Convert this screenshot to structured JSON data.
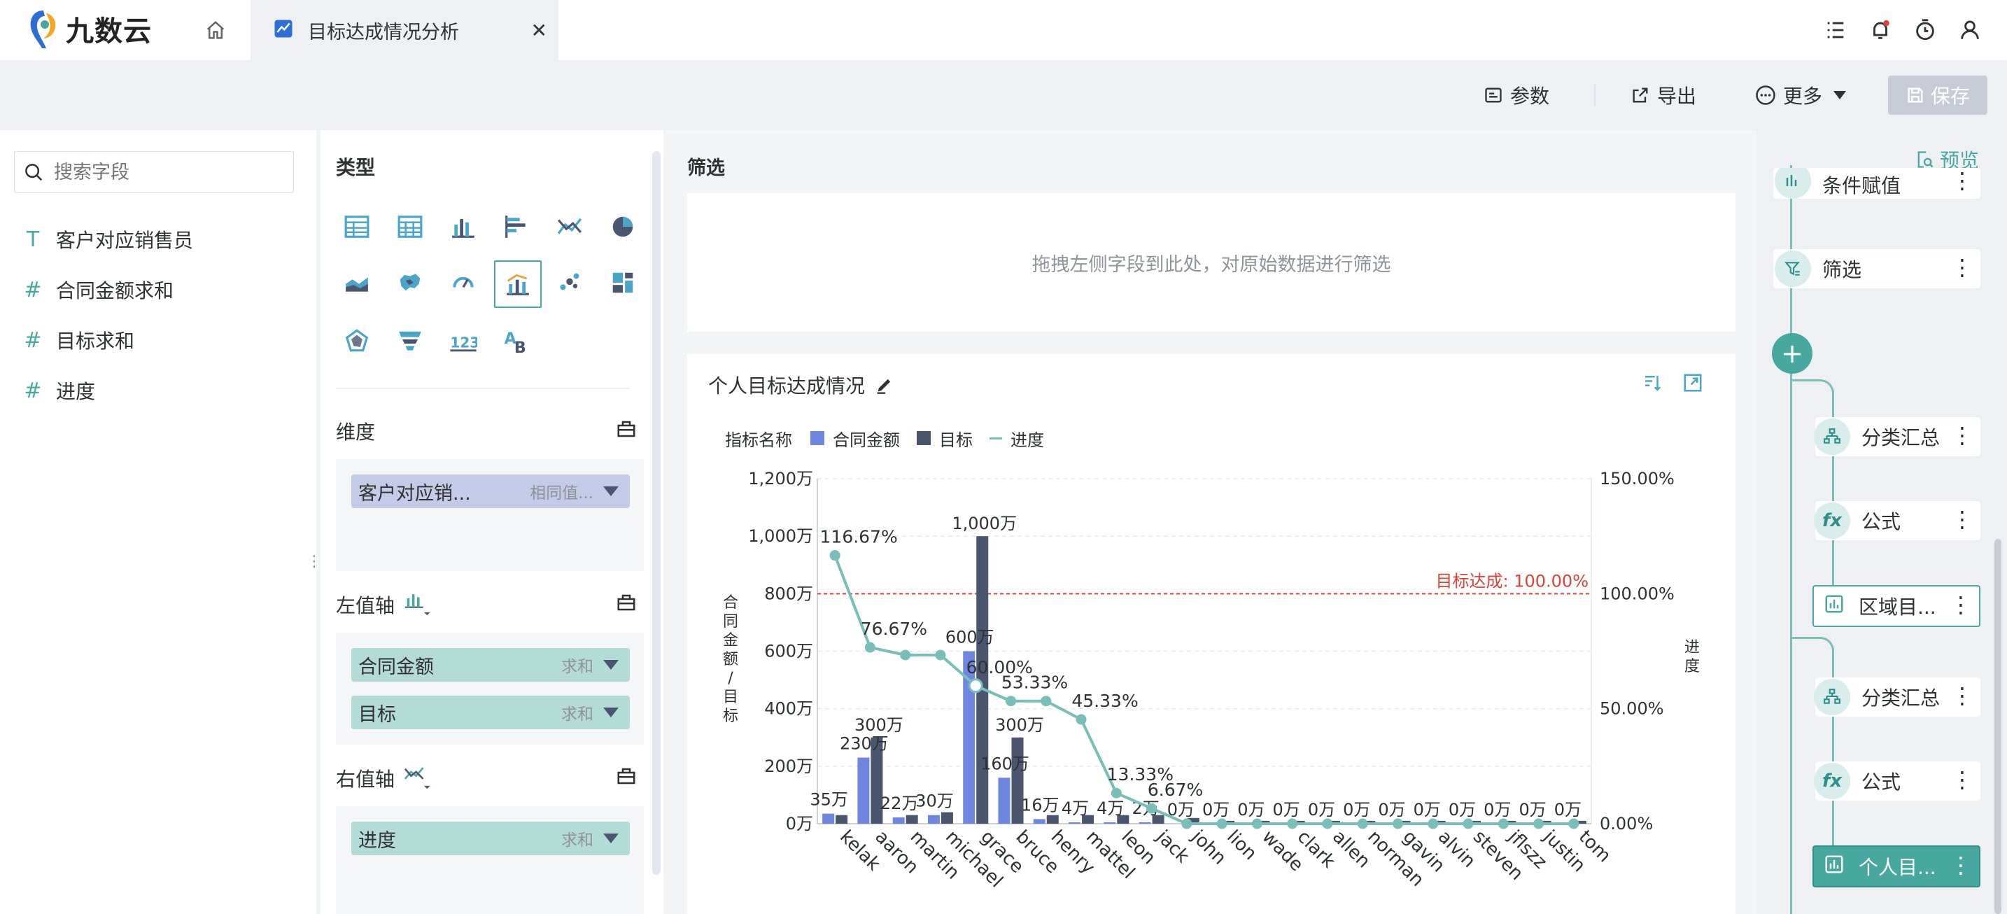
{
  "app": {
    "name": "九数云"
  },
  "tab": {
    "title": "目标达成情况分析"
  },
  "toolbar": {
    "params": "参数",
    "export": "导出",
    "more": "更多",
    "save": "保存"
  },
  "fields": {
    "search_placeholder": "搜索字段",
    "items": [
      {
        "type": "T",
        "label": "客户对应销售员"
      },
      {
        "type": "#",
        "label": "合同金额求和"
      },
      {
        "type": "#",
        "label": "目标求和"
      },
      {
        "type": "#",
        "label": "进度"
      }
    ]
  },
  "config": {
    "type_title": "类型",
    "dimension_title": "维度",
    "dimension_pill": {
      "name": "客户对应销...",
      "agg": "相同值..."
    },
    "left_axis_title": "左值轴",
    "left_pills": [
      {
        "name": "合同金额",
        "agg": "求和"
      },
      {
        "name": "目标",
        "agg": "求和"
      }
    ],
    "right_axis_title": "右值轴",
    "right_pills": [
      {
        "name": "进度",
        "agg": "求和"
      }
    ]
  },
  "filter": {
    "title": "筛选",
    "placeholder": "拖拽左侧字段到此处，对原始数据进行筛选"
  },
  "chart": {
    "title": "个人目标达成情况"
  },
  "chart_data": {
    "type": "bar",
    "legend_title": "指标名称",
    "categories": [
      "kelak",
      "aaron",
      "martin",
      "michael",
      "grace",
      "bruce",
      "henry",
      "mattel",
      "leon",
      "jack",
      "john",
      "lion",
      "wade",
      "clark",
      "allen",
      "norman",
      "gavin",
      "alvin",
      "steven",
      "jflszz",
      "justin",
      "tom"
    ],
    "series": [
      {
        "name": "合同金额",
        "type": "bar",
        "axis": "left",
        "color": "#6f86e0",
        "values": [
          35,
          230,
          22,
          30,
          600,
          160,
          16,
          4,
          4,
          2,
          0,
          0,
          0,
          0,
          0,
          0,
          0,
          0,
          0,
          0,
          0,
          0
        ],
        "labels": [
          "35万",
          "230万",
          "22万",
          "30万",
          "600万",
          "160万",
          "16万",
          "4万",
          "4万",
          "2万",
          "0万",
          "0万",
          "0万",
          "0万",
          "0万",
          "0万",
          "0万",
          "0万",
          "0万",
          "0万",
          "0万",
          "0万"
        ]
      },
      {
        "name": "目标",
        "type": "bar",
        "axis": "left",
        "color": "#4a5670",
        "values": [
          30,
          300,
          30,
          40,
          1000,
          300,
          30,
          30,
          30,
          30,
          20,
          10,
          10,
          10,
          10,
          10,
          10,
          10,
          10,
          10,
          10,
          10
        ],
        "labels": [
          "",
          "300万",
          "",
          "",
          "1,000万",
          "300万",
          "",
          "",
          "",
          "",
          "",
          "",
          "",
          "",
          "",
          "",
          "",
          "",
          "",
          "",
          "",
          ""
        ]
      },
      {
        "name": "进度",
        "type": "line",
        "axis": "right",
        "color": "#78bfb8",
        "values": [
          116.67,
          76.67,
          73.33,
          73.33,
          60.0,
          53.33,
          53.33,
          45.33,
          13.33,
          6.67,
          0,
          0,
          0,
          0,
          0,
          0,
          0,
          0,
          0,
          0,
          0,
          0
        ],
        "labels": [
          "116.67%",
          "76.67%",
          "",
          "",
          "60.00%",
          "53.33%",
          "",
          "45.33%",
          "13.33%",
          "6.67%",
          "",
          "",
          "",
          "",
          "",
          "",
          "",
          "",
          "",
          "",
          "",
          ""
        ]
      }
    ],
    "ylabel": "合同金额/目标",
    "y2label": "进度",
    "ylim": [
      0,
      1200
    ],
    "yticks": [
      "0万",
      "200万",
      "400万",
      "600万",
      "800万",
      "1,000万",
      "1,200万"
    ],
    "y2lim": [
      0,
      150
    ],
    "y2ticks": [
      "0.00%",
      "50.00%",
      "100.00%",
      "150.00%"
    ],
    "target_line": {
      "value": 100,
      "label": "目标达成: 100.00%",
      "color": "#e0403a"
    },
    "grid": true,
    "legend_position": "top-left"
  },
  "flow": {
    "preview": "预览",
    "nodes": [
      {
        "label": "条件赋值",
        "icon": "condition-icon"
      },
      {
        "label": "筛选",
        "icon": "filter-icon"
      },
      {
        "label": "分类汇总",
        "icon": "group-icon"
      },
      {
        "label": "公式",
        "icon": "formula-icon"
      },
      {
        "label": "区域目...",
        "icon": "chart-icon"
      },
      {
        "label": "分类汇总",
        "icon": "group-icon"
      },
      {
        "label": "公式",
        "icon": "formula-icon"
      },
      {
        "label": "个人目...",
        "icon": "chart-icon"
      }
    ]
  }
}
